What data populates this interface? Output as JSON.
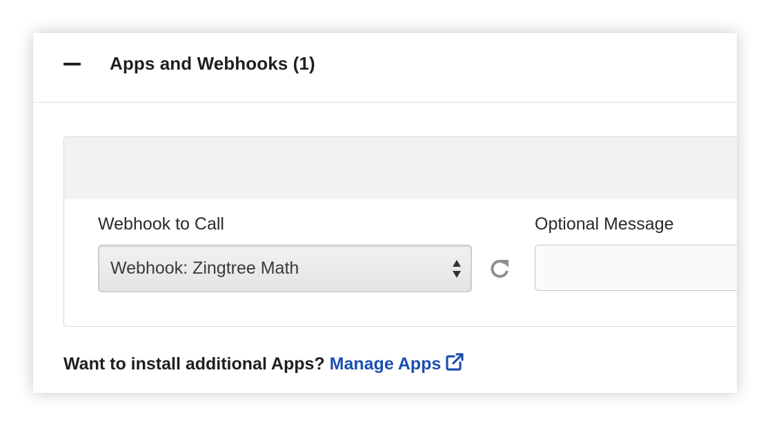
{
  "section": {
    "title": "Apps and Webhooks (1)",
    "toggle_icon": "minus-icon"
  },
  "webhook_field": {
    "label": "Webhook to Call",
    "selected_value": "Webhook: Zingtree Math",
    "arrows_icon": "sort-arrows-icon",
    "refresh_icon": "refresh-icon"
  },
  "message_field": {
    "label": "Optional Message",
    "value": "",
    "placeholder": ""
  },
  "footer": {
    "prompt": "Want to install additional Apps?",
    "link_label": "Manage Apps",
    "link_icon": "external-link-icon",
    "link_color": "#1b4fae"
  }
}
